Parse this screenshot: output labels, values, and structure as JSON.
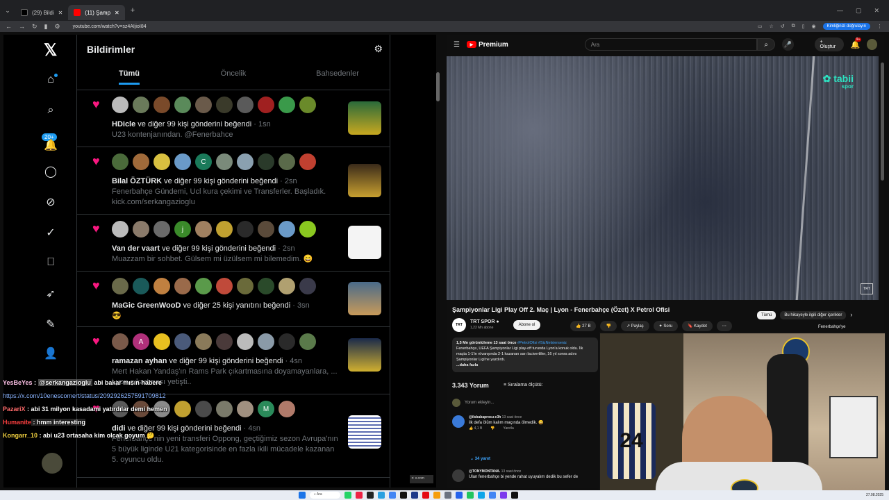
{
  "browser": {
    "tabs": [
      {
        "label": "(29) Bildi"
      },
      {
        "label": "(11) Şamp"
      }
    ],
    "url": "youtube.com/watch?v=sz4AIjioI84",
    "verify_label": "Kimliğinizi doğrulayın"
  },
  "x": {
    "title": "Bildirimler",
    "tabs": [
      "Tümü",
      "Öncelik",
      "Bahsedenler"
    ],
    "badge": "20+",
    "notifications": [
      {
        "who": "HDicle",
        "rest": " ve diğer 99 kişi gönderini beğendi",
        "time": " · 1sn",
        "sub": "U23 kontenjanından. @Fenerbahce"
      },
      {
        "who": "Bilal ÖZTÜRK",
        "rest": " ve diğer 99 kişi gönderini beğendi",
        "time": " · 2sn",
        "sub": "Fenerbahçe Gündemi, Ucl kura çekimi ve Transferler. Başladık. kick.com/serkangazioglu"
      },
      {
        "who": "Van der vaart",
        "rest": " ve diğer 99 kişi gönderini beğendi",
        "time": " · 2sn",
        "sub": "Muazzam bir sohbet. Gülsem mi üzülsem mi bilemedim. 😄"
      },
      {
        "who": "MaGic GreenWooD",
        "rest": " ve diğer 25 kişi yanıtını beğendi",
        "time": " · 3sn",
        "sub": "😎"
      },
      {
        "who": "ramazan ayhan",
        "rest": " ve diğer 99 kişi gönderini beğendi",
        "time": " · 4sn",
        "sub": "Mert Hakan Yandaş'ın Rams Park çıkartmasına doyamayanlara, ... Lyon çıkartması yetişti.."
      },
      {
        "who": "didi",
        "rest": " ve diğer 99 kişi gönderini beğendi",
        "time": " · 4sn",
        "sub": "Fenerbahçe'nin yeni transferi Oppong, geçtiğimiz sezon Avrupa'nın 5 büyük liginde U21 kategorisinde en fazla ikili mücadele kazanan 5. oyuncu oldu."
      }
    ]
  },
  "yt": {
    "premium": "Premium",
    "search_placeholder": "Ara",
    "create": "Oluştur",
    "bell_count": "9+",
    "video_title": "Şampiyonlar Ligi Play Off 2. Maç | Lyon - Fenerbahçe (Özet) X Petrol Ofisi",
    "watermark": "tabii",
    "watermark_sub": "spor",
    "chips": [
      "Tümü",
      "Bu hikayeyle ilgili diğer içerikler"
    ],
    "channel": "TRT SPOR",
    "subs": "1,22 Mn abone",
    "subscribe": "Abone ol",
    "actions": [
      "👍 27 B",
      "👎",
      "↗ Paylaş",
      "✦ Soru",
      "🔖 Kaydet",
      "⋯"
    ],
    "desc_stats": "1,5 Mn görüntüleme  13 saat önce",
    "desc_tags": " #PetrolOfisi #SizNelsterseniz",
    "desc_body": "Fenerbahçe, UEFA Şampiyonlar Ligi play-off turunda Lyon'a konuk oldu. İlk maçta 1-1'in rövanşında 2-1 kazanan sarı lacivertliler, 16 yıl sonra adını Şampiyonlar Ligi'ne yazdırdı.",
    "desc_more": "...daha fazla",
    "side_channel": "Fenerbahçe'ye",
    "comments_count": "3.343 Yorum",
    "sort": "Sıralama ölçütü:",
    "add_comment": "Yorum ekleyin...",
    "comments": [
      {
        "user": "@ilsbabaprosu-c3h",
        "when": "13 saat önce",
        "text": "ilk defa ölüm kalım maçında ölmedik. 😄",
        "likes": "4,1 B",
        "reply": "Yanıtla"
      },
      {
        "user": "@TONYMONTANA.",
        "when": "13 saat önce",
        "text": "Ulan fenerbahçe bi yende rahat uyuyalım dedik bu sefer de",
        "likes": "",
        "reply": ""
      }
    ],
    "replies": "34 yanıt"
  },
  "x_tab_label": "x.com",
  "chat": [
    {
      "user": "YesBeYes",
      "text": " abi bakar mısın habere",
      "mention": "@serkangazioglu"
    },
    {
      "user": "",
      "link": "https://x.com/10enescomert/status/2092926257591709812"
    },
    {
      "user": "PazariX",
      "text": " : abi 31 milyon kasadami yatırdılar demi hemen"
    },
    {
      "user": "Humanite",
      "text": " : hmm interesting"
    },
    {
      "user": "Kongarr_10",
      "text": " : abi u23 ortasaha kim olcak goyum 🤔"
    }
  ],
  "taskbar": {
    "search": "Ara",
    "date": "27.08.2025"
  },
  "colors": {
    "x_like": "#f91880",
    "x_accent": "#1d9bf0",
    "yt_red": "#ff0000",
    "yt_link": "#3ea6ff"
  }
}
